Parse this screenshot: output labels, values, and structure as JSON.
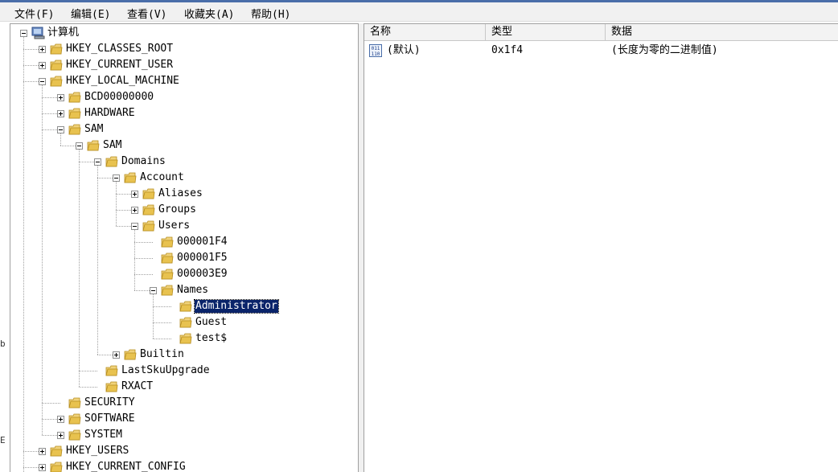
{
  "menu": [
    {
      "label": "文件(F)"
    },
    {
      "label": "编辑(E)"
    },
    {
      "label": "查看(V)"
    },
    {
      "label": "收藏夹(A)"
    },
    {
      "label": "帮助(H)"
    }
  ],
  "left_edge_chars": [
    "b",
    "E"
  ],
  "tree": [
    {
      "label": "计算机",
      "depth": 0,
      "expander": "minus",
      "icon": "computer-icon"
    },
    {
      "label": "HKEY_CLASSES_ROOT",
      "depth": 1,
      "expander": "plus",
      "icon": "folder-icon"
    },
    {
      "label": "HKEY_CURRENT_USER",
      "depth": 1,
      "expander": "plus",
      "icon": "folder-icon"
    },
    {
      "label": "HKEY_LOCAL_MACHINE",
      "depth": 1,
      "expander": "minus",
      "icon": "folder-icon"
    },
    {
      "label": "BCD00000000",
      "depth": 2,
      "expander": "plus",
      "icon": "folder-icon"
    },
    {
      "label": "HARDWARE",
      "depth": 2,
      "expander": "plus",
      "icon": "folder-icon"
    },
    {
      "label": "SAM",
      "depth": 2,
      "expander": "minus",
      "icon": "folder-icon"
    },
    {
      "label": "SAM",
      "depth": 3,
      "expander": "minus",
      "icon": "folder-icon"
    },
    {
      "label": "Domains",
      "depth": 4,
      "expander": "minus",
      "icon": "folder-icon"
    },
    {
      "label": "Account",
      "depth": 5,
      "expander": "minus",
      "icon": "folder-icon"
    },
    {
      "label": "Aliases",
      "depth": 6,
      "expander": "plus",
      "icon": "folder-icon"
    },
    {
      "label": "Groups",
      "depth": 6,
      "expander": "plus",
      "icon": "folder-icon"
    },
    {
      "label": "Users",
      "depth": 6,
      "expander": "minus",
      "icon": "folder-icon"
    },
    {
      "label": "000001F4",
      "depth": 7,
      "expander": "none",
      "icon": "folder-icon"
    },
    {
      "label": "000001F5",
      "depth": 7,
      "expander": "none",
      "icon": "folder-icon"
    },
    {
      "label": "000003E9",
      "depth": 7,
      "expander": "none",
      "icon": "folder-icon"
    },
    {
      "label": "Names",
      "depth": 7,
      "expander": "minus",
      "icon": "folder-icon"
    },
    {
      "label": "Administrator",
      "depth": 8,
      "expander": "none",
      "icon": "folder-icon",
      "selected": true
    },
    {
      "label": "Guest",
      "depth": 8,
      "expander": "none",
      "icon": "folder-icon"
    },
    {
      "label": "test$",
      "depth": 8,
      "expander": "none",
      "icon": "folder-icon"
    },
    {
      "label": "Builtin",
      "depth": 5,
      "expander": "plus",
      "icon": "folder-icon"
    },
    {
      "label": "LastSkuUpgrade",
      "depth": 4,
      "expander": "none",
      "icon": "folder-icon"
    },
    {
      "label": "RXACT",
      "depth": 4,
      "expander": "none",
      "icon": "folder-icon"
    },
    {
      "label": "SECURITY",
      "depth": 2,
      "expander": "none",
      "icon": "folder-icon"
    },
    {
      "label": "SOFTWARE",
      "depth": 2,
      "expander": "plus",
      "icon": "folder-icon"
    },
    {
      "label": "SYSTEM",
      "depth": 2,
      "expander": "plus",
      "icon": "folder-icon"
    },
    {
      "label": "HKEY_USERS",
      "depth": 1,
      "expander": "plus",
      "icon": "folder-icon"
    },
    {
      "label": "HKEY_CURRENT_CONFIG",
      "depth": 1,
      "expander": "plus",
      "icon": "folder-icon"
    }
  ],
  "list": {
    "columns": [
      {
        "label": "名称"
      },
      {
        "label": "类型"
      },
      {
        "label": "数据"
      }
    ],
    "rows": [
      {
        "name": "(默认)",
        "type": "0x1f4",
        "data": "(长度为零的二进制值)",
        "icon": "binary-value-icon",
        "icon_text": "011 110"
      }
    ]
  },
  "colors": {
    "selection_bg": "#0a246a",
    "folder": "#e8c24f",
    "menubar_bg": "#f1f1f1"
  }
}
